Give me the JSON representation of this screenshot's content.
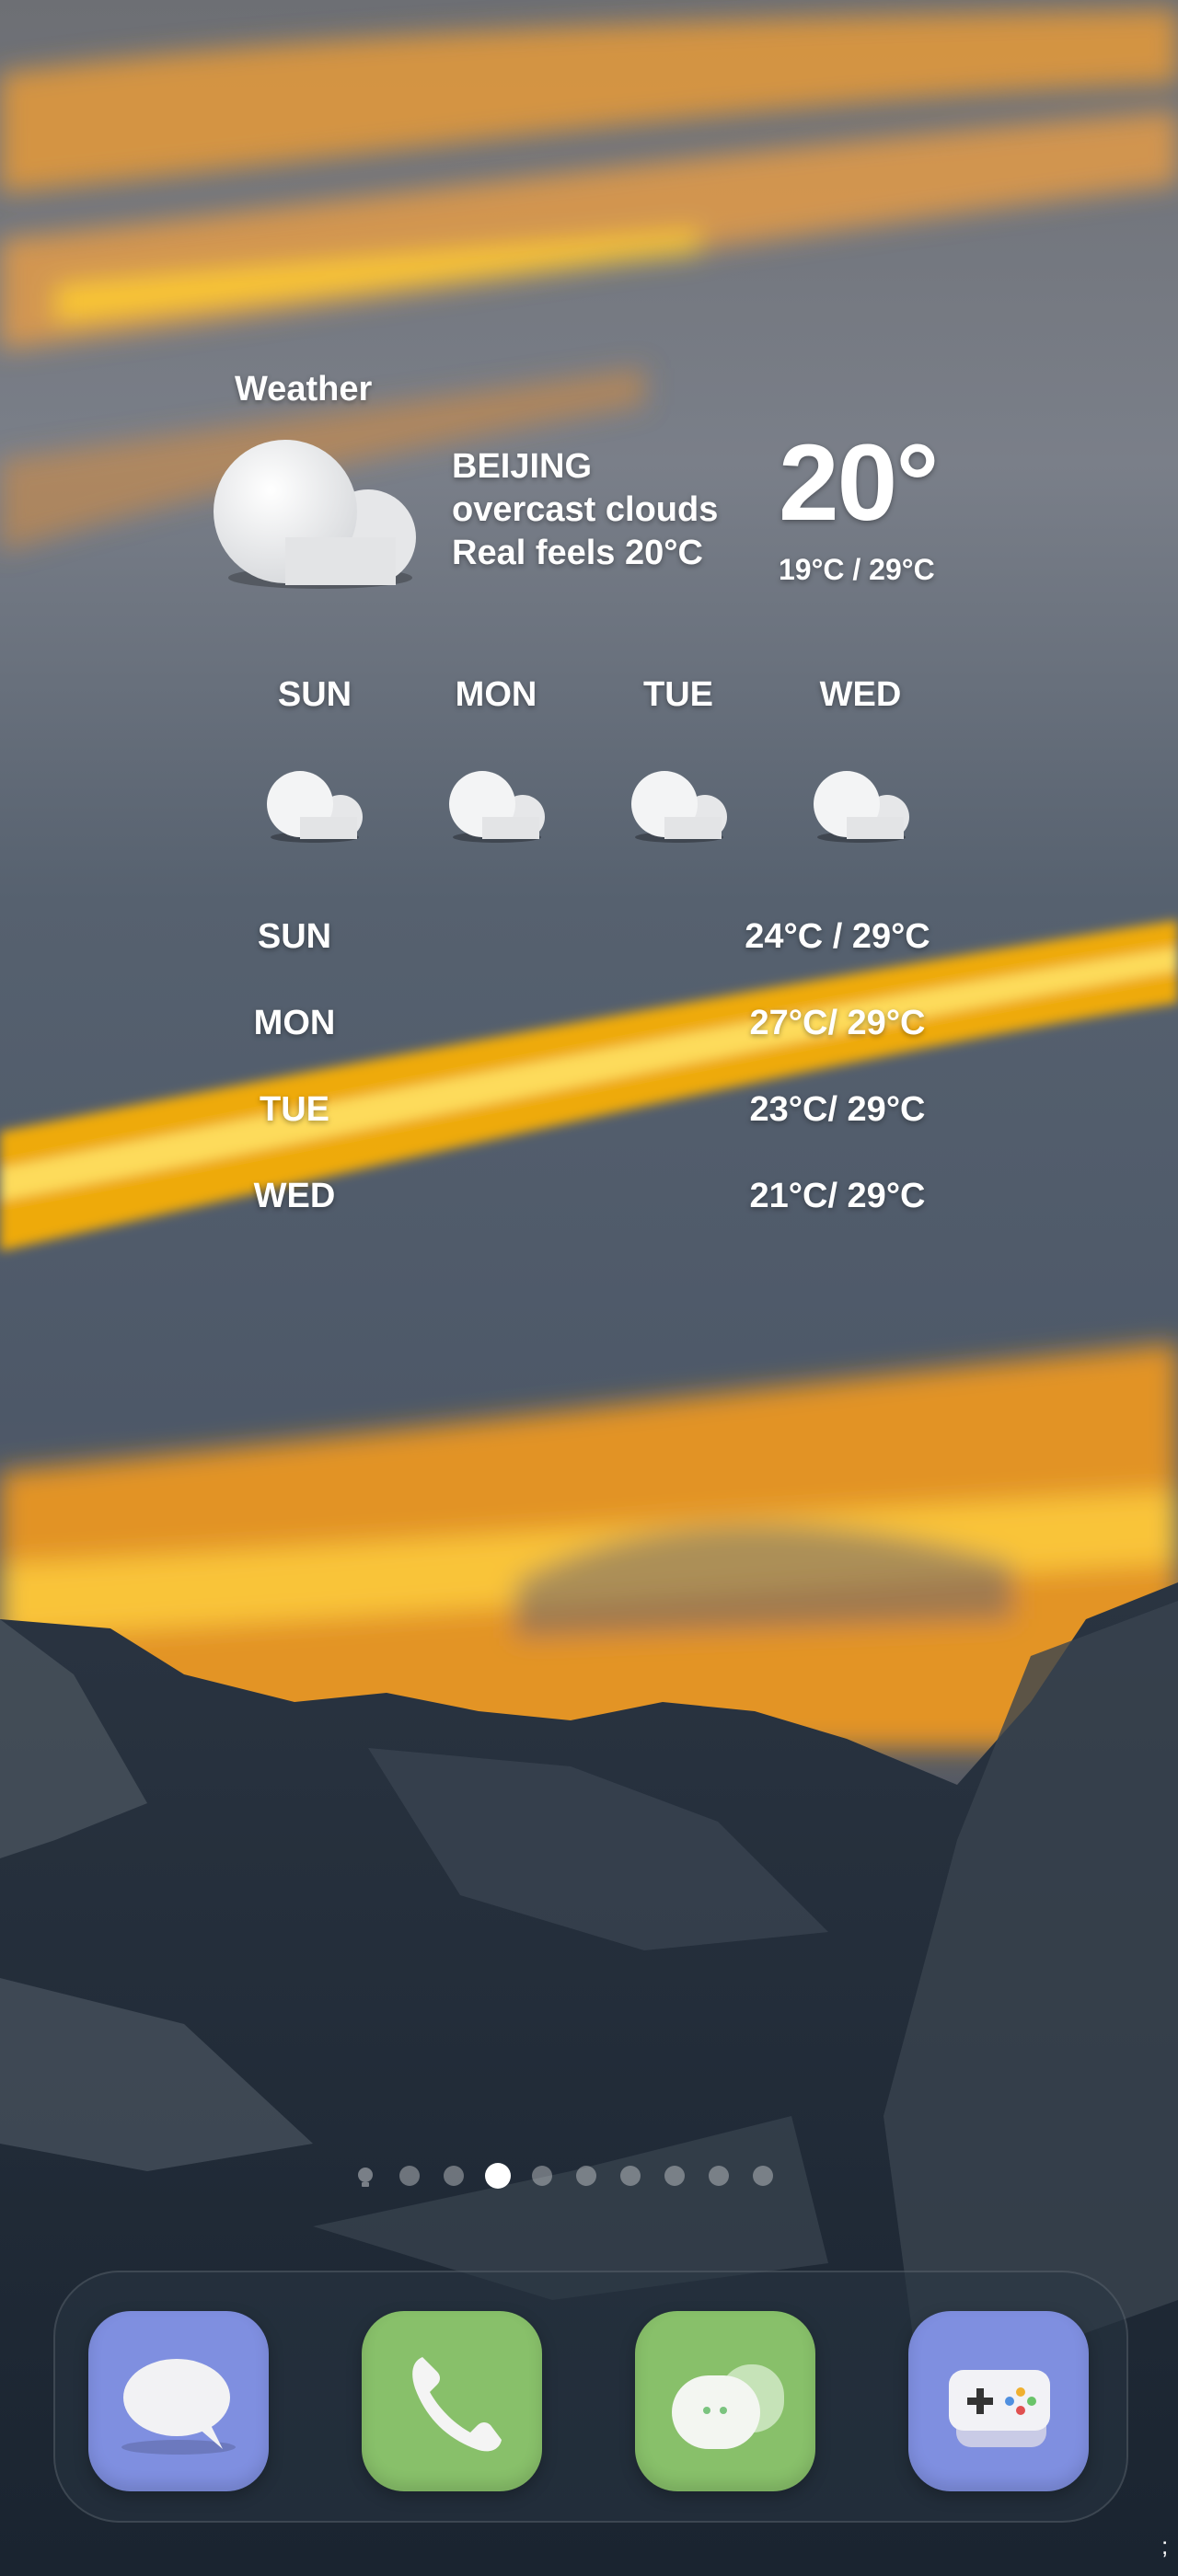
{
  "widget": {
    "title": "Weather",
    "city": "BEIJING",
    "condition": "overcast clouds",
    "real_feel": "Real feels 20°C",
    "temperature": "20°",
    "range": "19°C / 29°C",
    "condition_icon": "cloud-icon",
    "daily": [
      {
        "day": "SUN",
        "icon": "cloud-icon"
      },
      {
        "day": "MON",
        "icon": "cloud-icon"
      },
      {
        "day": "TUE",
        "icon": "cloud-icon"
      },
      {
        "day": "WED",
        "icon": "cloud-icon"
      }
    ],
    "forecast": [
      {
        "day": "SUN",
        "range": "24°C / 29°C"
      },
      {
        "day": "MON",
        "range": "27°C/ 29°C"
      },
      {
        "day": "TUE",
        "range": "23°C/ 29°C"
      },
      {
        "day": "WED",
        "range": "21°C/ 29°C"
      }
    ]
  },
  "page_indicator": {
    "total_pages": 10,
    "active_page": 3,
    "first_icon": "lightbulb-icon"
  },
  "dock": {
    "apps": [
      {
        "name": "Messages",
        "icon": "chat-bubble-icon",
        "color": "#7f8fe0"
      },
      {
        "name": "Phone",
        "icon": "phone-icon",
        "color": "#88c06a"
      },
      {
        "name": "Messenger",
        "icon": "message-bubbles-icon",
        "color": "#88c06a"
      },
      {
        "name": "Games",
        "icon": "gamepad-icon",
        "color": "#7f8fe0"
      }
    ]
  },
  "status_glyph": ";",
  "colors": {
    "sky_top": "#6f7580",
    "sunset_orange": "#ffb020",
    "mountain_dark": "#1f2a36",
    "widget_text": "#ffffff"
  }
}
